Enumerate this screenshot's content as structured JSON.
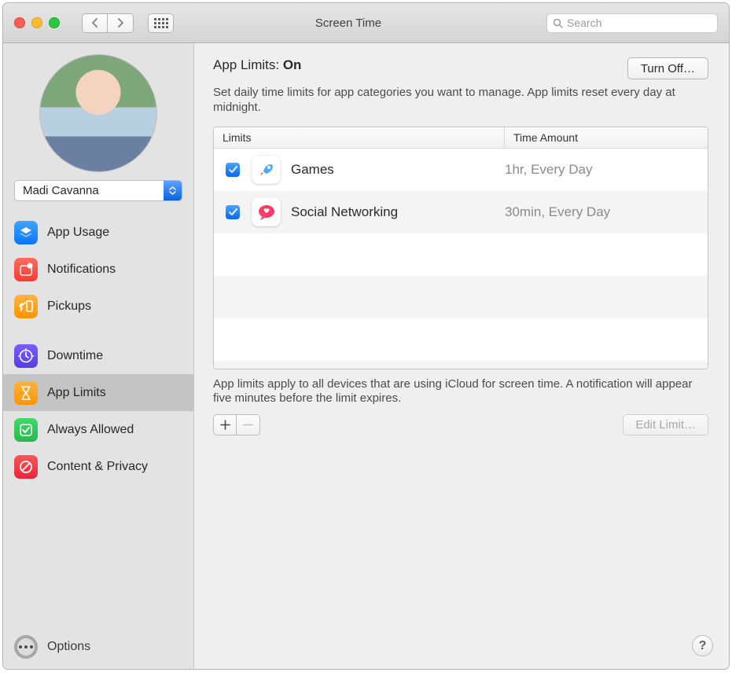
{
  "window": {
    "title": "Screen Time"
  },
  "toolbar": {
    "search_placeholder": "Search"
  },
  "user": {
    "name": "Madi Cavanna"
  },
  "sidebar": {
    "groups": [
      [
        {
          "id": "app-usage",
          "label": "App Usage",
          "icon": "layers-icon",
          "color": "blue"
        },
        {
          "id": "notifications",
          "label": "Notifications",
          "icon": "badge-icon",
          "color": "red"
        },
        {
          "id": "pickups",
          "label": "Pickups",
          "icon": "pickup-icon",
          "color": "orange"
        }
      ],
      [
        {
          "id": "downtime",
          "label": "Downtime",
          "icon": "clock-icon",
          "color": "purple"
        },
        {
          "id": "app-limits",
          "label": "App Limits",
          "icon": "hourglass-icon",
          "color": "orange",
          "selected": true
        },
        {
          "id": "always-allowed",
          "label": "Always Allowed",
          "icon": "check-shield-icon",
          "color": "green"
        },
        {
          "id": "content-privacy",
          "label": "Content & Privacy",
          "icon": "no-entry-icon",
          "color": "redc"
        }
      ]
    ],
    "footer": {
      "label": "Options"
    }
  },
  "main": {
    "heading_prefix": "App Limits: ",
    "heading_state": "On",
    "turn_off_label": "Turn Off…",
    "description": "Set daily time limits for app categories you want to manage. App limits reset every day at midnight.",
    "columns": {
      "limits": "Limits",
      "time": "Time Amount"
    },
    "limits": [
      {
        "enabled": true,
        "icon": "rocket-icon",
        "name": "Games",
        "time": "1hr, Every Day"
      },
      {
        "enabled": true,
        "icon": "chat-heart-icon",
        "name": "Social Networking",
        "time": "30min, Every Day"
      }
    ],
    "footer_note": "App limits apply to all devices that are using iCloud for screen time. A notification will appear five minutes before the limit expires.",
    "edit_label": "Edit Limit…"
  }
}
